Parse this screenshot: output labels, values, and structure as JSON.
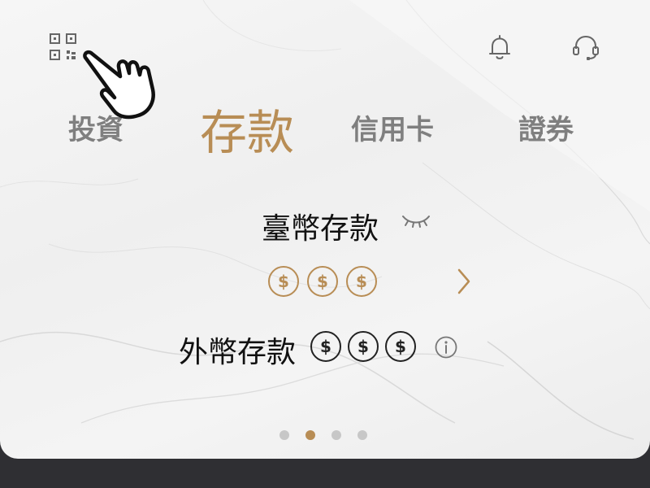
{
  "tabs": [
    {
      "label": "投資",
      "active": false
    },
    {
      "label": "存款",
      "active": true
    },
    {
      "label": "信用卡",
      "active": false
    },
    {
      "label": "證券",
      "active": false
    }
  ],
  "icons": {
    "top_left": "qr-code-icon",
    "top_right": [
      "bell-icon",
      "headset-icon"
    ],
    "pointer": "pointing-hand-icon"
  },
  "twd_deposit": {
    "title": "臺幣存款",
    "balance_masked": [
      "$",
      "$",
      "$"
    ],
    "visibility_icon": "eye-closed-icon",
    "next_icon": "chevron-right-icon"
  },
  "fx_deposit": {
    "title": "外幣存款",
    "balance_masked": [
      "$",
      "$",
      "$"
    ],
    "info_icon": "info-icon"
  },
  "pager": {
    "count": 4,
    "active_index": 1
  },
  "colors": {
    "accent_gold": "#b88d55",
    "tab_inactive": "#7f7f7f",
    "text_dark": "#111111",
    "bottom_bar": "#2f2f33"
  }
}
